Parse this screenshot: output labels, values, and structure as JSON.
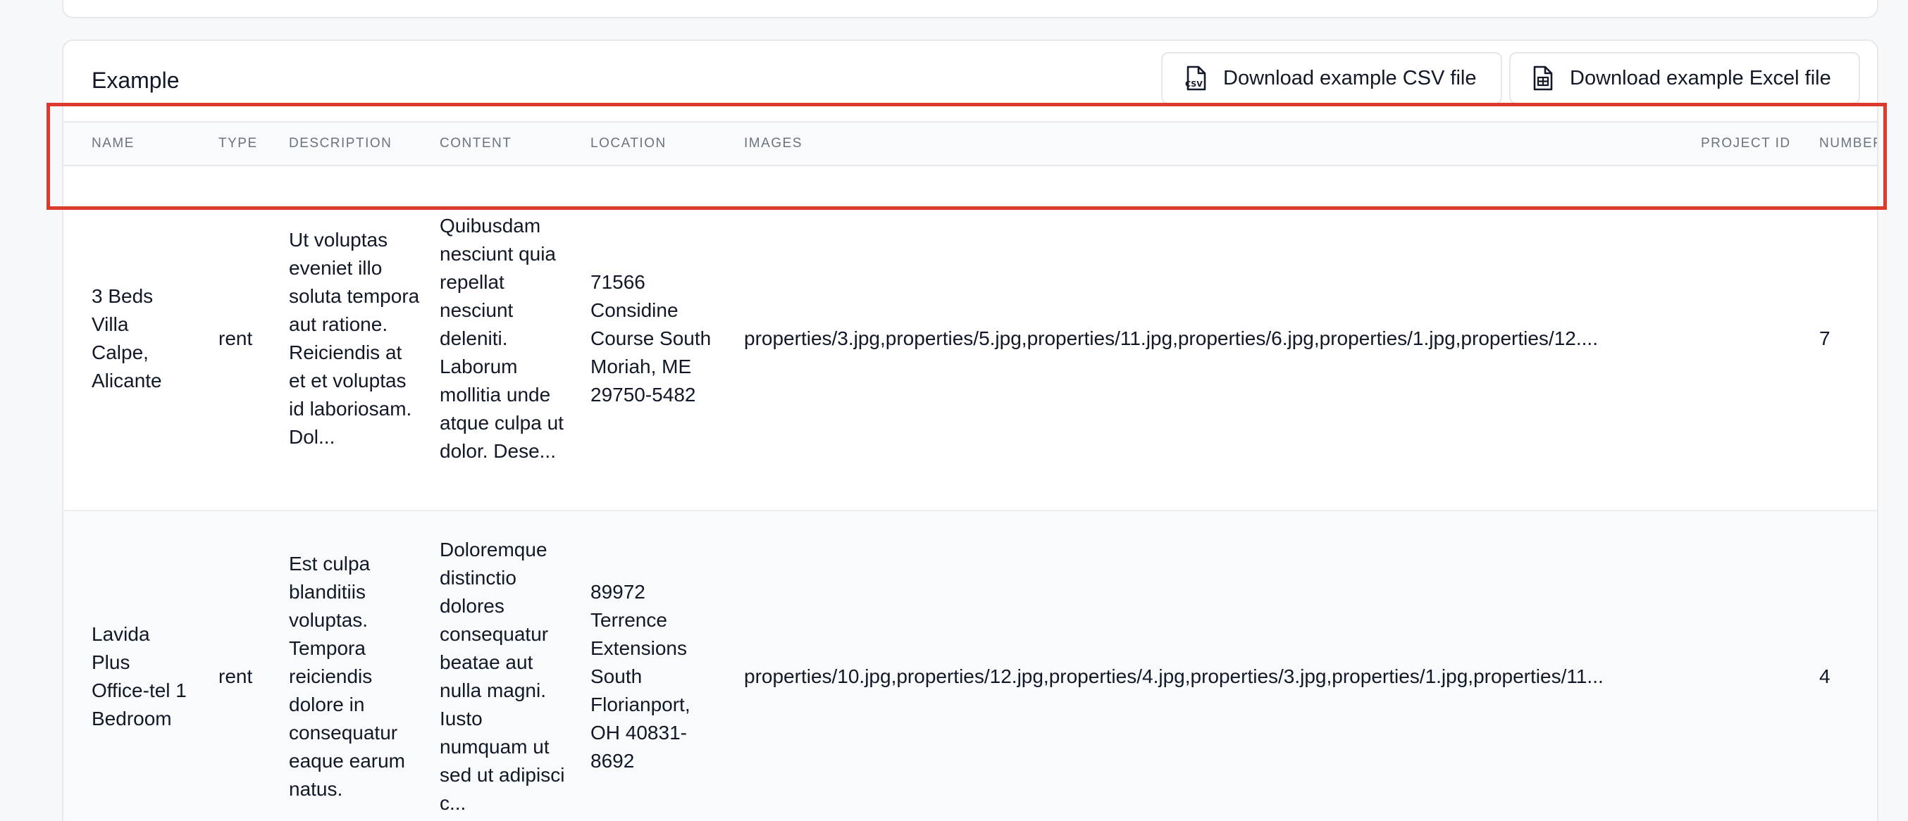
{
  "card": {
    "title": "Example",
    "download_csv_label": "Download example CSV file",
    "download_excel_label": "Download example Excel file"
  },
  "table": {
    "columns": [
      "Name",
      "Type",
      "Description",
      "Content",
      "Location",
      "Images",
      "Project ID",
      "Number"
    ],
    "rows": [
      {
        "name": "3 Beds Villa Calpe, Alicante",
        "type": "rent",
        "description": "Ut voluptas eveniet illo soluta tempora aut ratione. Reiciendis at et et voluptas id laboriosam. Dol...",
        "content": "Quibusdam nesciunt quia repellat nesciunt deleniti. Laborum mollitia unde atque culpa ut dolor. Dese...",
        "location": "71566 Considine Course South Moriah, ME 29750-5482",
        "images": "properties/3.jpg,properties/5.jpg,properties/11.jpg,properties/6.jpg,properties/1.jpg,properties/12....",
        "number": "7"
      },
      {
        "name": "Lavida Plus Office-tel 1 Bedroom",
        "type": "rent",
        "description": "Est culpa blanditiis voluptas. Tempora reiciendis dolore in consequatur eaque earum natus.",
        "content": "Doloremque distinctio dolores consequatur beatae aut nulla magni. Iusto numquam ut sed ut adipisci c...",
        "location": "89972 Terrence Extensions South Florianport, OH 40831-8692",
        "images": "properties/10.jpg,properties/12.jpg,properties/4.jpg,properties/3.jpg,properties/1.jpg,properties/11...",
        "number": "4"
      }
    ]
  },
  "icons": {
    "csv_file": "csv-file-icon",
    "excel_file": "excel-file-icon"
  },
  "colors": {
    "highlight": "#dc3a2c",
    "header_bg": "#f9fafb",
    "page_bg": "#f7f8fa"
  }
}
